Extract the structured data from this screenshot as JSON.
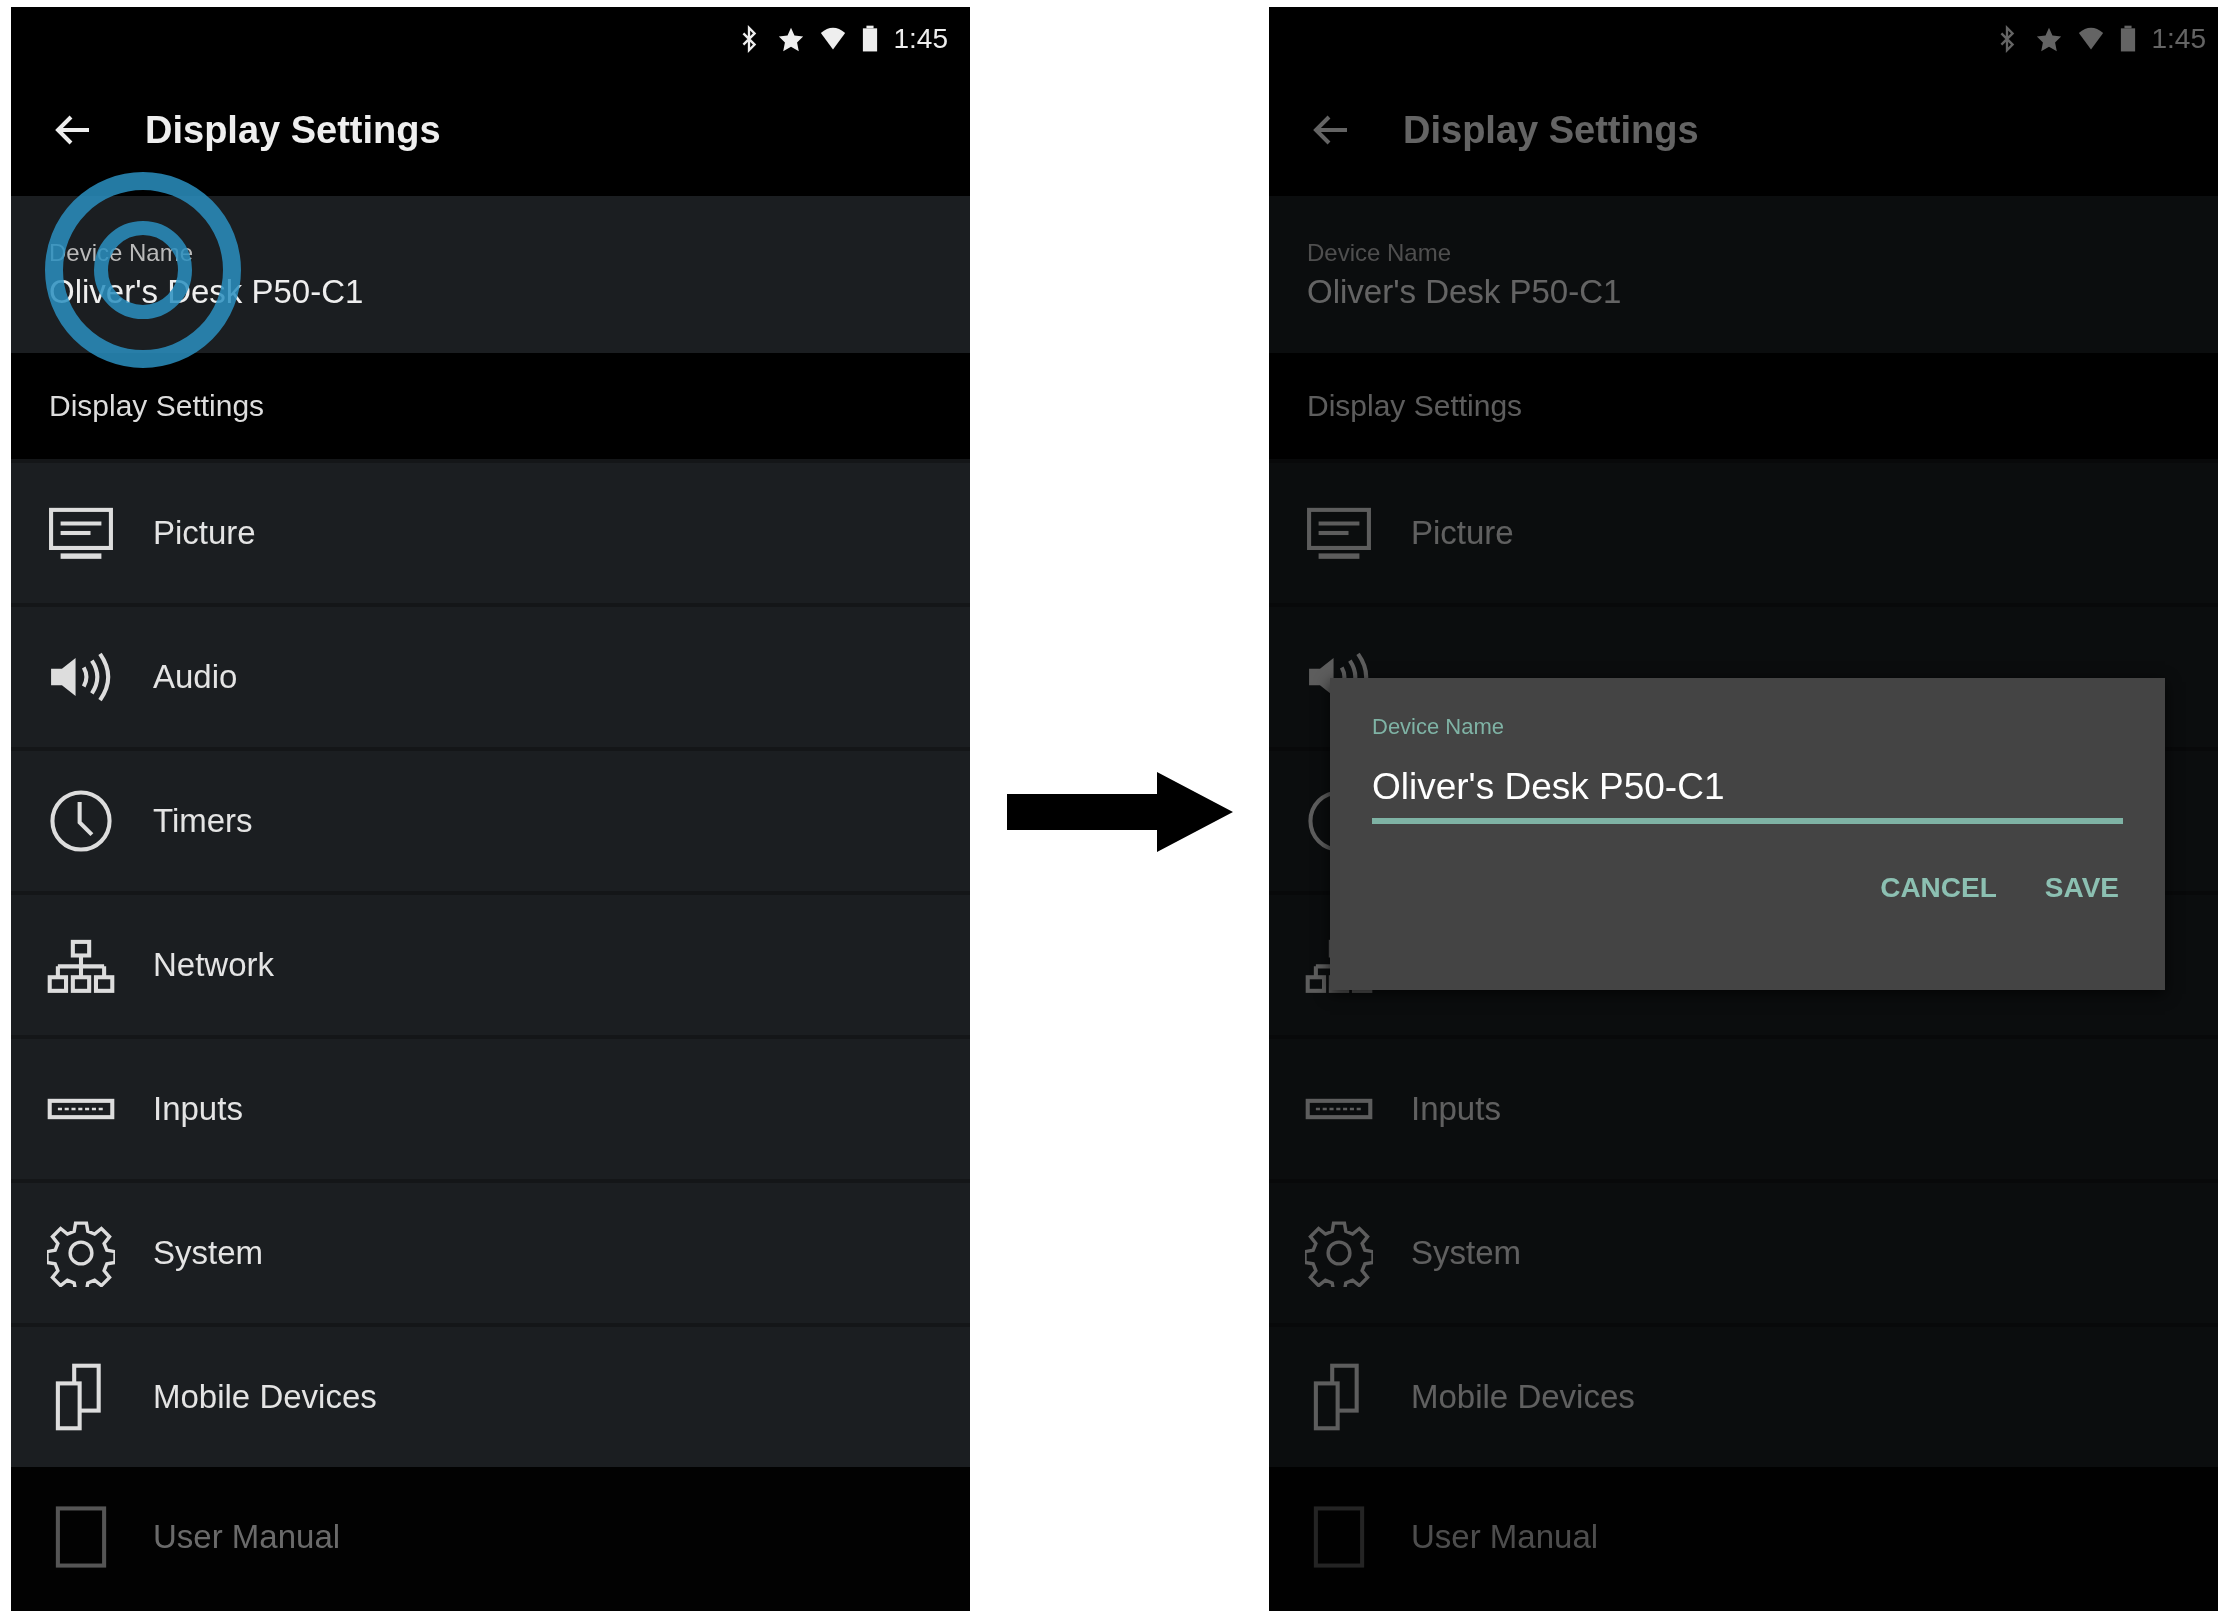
{
  "screens": [
    {
      "dimmed": false,
      "tap_indicator": true,
      "status_bar": {
        "time": "1:45"
      },
      "toolbar": {
        "title": "Display Settings"
      },
      "device_card": {
        "label": "Device Name",
        "value": "Oliver's Desk P50-C1"
      },
      "section_header": "Display Settings",
      "rows": [
        {
          "kind": "monitor",
          "label": "Picture"
        },
        {
          "kind": "speaker",
          "label": "Audio"
        },
        {
          "kind": "clock",
          "label": "Timers"
        },
        {
          "kind": "network",
          "label": "Network"
        },
        {
          "kind": "keyboard",
          "label": "Inputs"
        },
        {
          "kind": "gear",
          "label": "System"
        },
        {
          "kind": "phones",
          "label": "Mobile Devices"
        }
      ],
      "footer_row": {
        "kind": "tablet",
        "label": "User Manual"
      }
    },
    {
      "dimmed": true,
      "status_bar": {
        "time": "1:45"
      },
      "toolbar": {
        "title": "Display Settings"
      },
      "device_card": {
        "label": "Device Name",
        "value": "Oliver's Desk P50-C1"
      },
      "section_header": "Display Settings",
      "rows": [
        {
          "kind": "monitor",
          "label": "Picture"
        },
        {
          "kind": "speaker"
        },
        {
          "kind": "clock"
        },
        {
          "kind": "network"
        },
        {
          "kind": "keyboard",
          "label": "Inputs"
        },
        {
          "kind": "gear",
          "label": "System"
        },
        {
          "kind": "phones",
          "label": "Mobile Devices"
        }
      ],
      "footer_row": {
        "kind": "tablet",
        "label": "User Manual"
      },
      "dialog": {
        "label": "Device Name",
        "value": "Oliver's Desk P50-C1",
        "buttons": [
          "CANCEL",
          "SAVE"
        ]
      }
    }
  ]
}
